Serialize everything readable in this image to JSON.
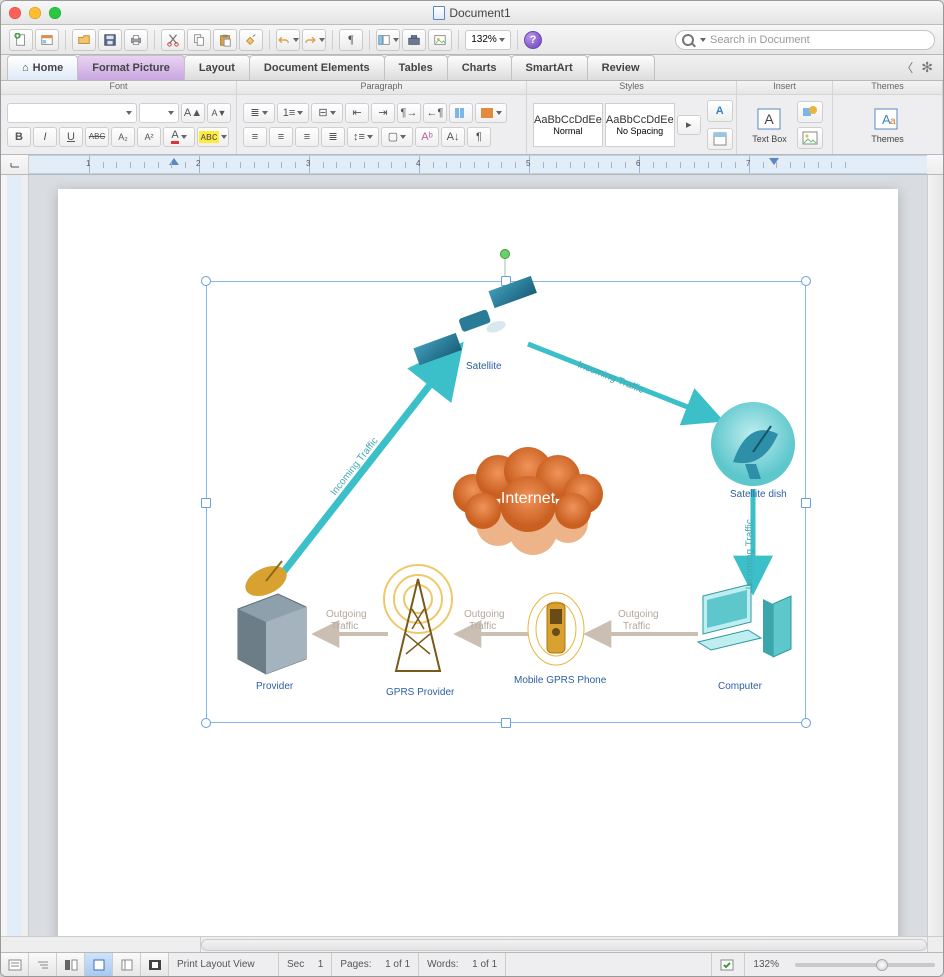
{
  "title": "Document1",
  "toolbar": {
    "zoom_display": "132%",
    "search_placeholder": "Search in Document"
  },
  "tabs": {
    "home": "Home",
    "format_picture": "Format Picture",
    "layout": "Layout",
    "document_elements": "Document Elements",
    "tables": "Tables",
    "charts": "Charts",
    "smartart": "SmartArt",
    "review": "Review"
  },
  "ribbon": {
    "groups": {
      "font": "Font",
      "paragraph": "Paragraph",
      "styles": "Styles",
      "insert": "Insert",
      "themes": "Themes"
    },
    "style_sample": "AaBbCcDdEe",
    "style_normal": "Normal",
    "style_nospacing": "No Spacing",
    "textbox_label": "Text Box",
    "themes_label": "Themes"
  },
  "ruler_numbers": [
    "1",
    "2",
    "3",
    "4",
    "5",
    "6",
    "7"
  ],
  "diagram": {
    "nodes": {
      "satellite": "Satellite",
      "satellite_dish": "Satellite dish",
      "internet": "Internet",
      "computer": "Computer",
      "mobile": "Mobile GPRS Phone",
      "gprs_provider": "GPRS Provider",
      "provider": "Provider"
    },
    "edges": {
      "incoming": "Incoming Traffic",
      "outgoing": "Outgoing Traffic",
      "outgoing_split1": "Outgoing",
      "outgoing_split2": "Traffic"
    }
  },
  "status": {
    "view_label": "Print Layout View",
    "sec_label": "Sec",
    "sec_value": "1",
    "pages_label": "Pages:",
    "pages_value": "1 of 1",
    "words_label": "Words:",
    "words_value": "1 of 1",
    "zoom_value": "132%"
  }
}
